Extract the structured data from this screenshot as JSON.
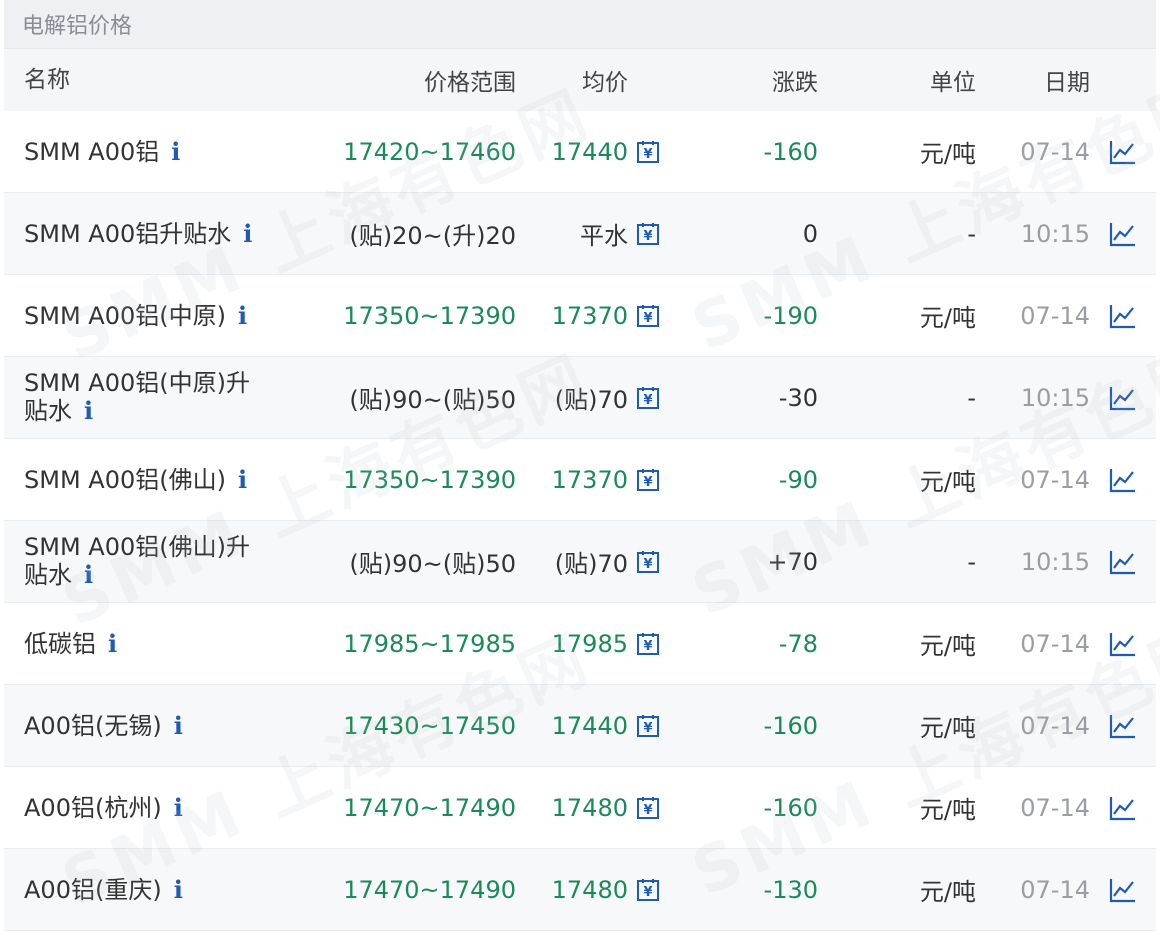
{
  "panel": {
    "title": "电解铝价格"
  },
  "columns": {
    "name": "名称",
    "range": "价格范围",
    "avg": "均价",
    "change": "涨跌",
    "unit": "单位",
    "date": "日期"
  },
  "rows": [
    {
      "name": "SMM A00铝",
      "info": "i",
      "range": "17420~17460",
      "avg": "17440",
      "change": "-160",
      "unit": "元/吨",
      "date": "07-14",
      "style": "price"
    },
    {
      "name": "SMM A00铝升贴水",
      "info": "i",
      "range": "(贴)20~(升)20",
      "avg": "平水",
      "change": "0",
      "unit": "-",
      "date": "10:15",
      "style": "premium"
    },
    {
      "name": "SMM A00铝(中原)",
      "info": "i",
      "range": "17350~17390",
      "avg": "17370",
      "change": "-190",
      "unit": "元/吨",
      "date": "07-14",
      "style": "price"
    },
    {
      "name": "SMM A00铝(中原)升贴水",
      "info": "i",
      "range": "(贴)90~(贴)50",
      "avg": "(贴)70",
      "change": "-30",
      "unit": "-",
      "date": "10:15",
      "style": "premium"
    },
    {
      "name": "SMM A00铝(佛山)",
      "info": "i",
      "range": "17350~17390",
      "avg": "17370",
      "change": "-90",
      "unit": "元/吨",
      "date": "07-14",
      "style": "price"
    },
    {
      "name": "SMM A00铝(佛山)升贴水",
      "info": "i",
      "range": "(贴)90~(贴)50",
      "avg": "(贴)70",
      "change": "+70",
      "unit": "-",
      "date": "10:15",
      "style": "premium"
    },
    {
      "name": "低碳铝",
      "info": "i",
      "range": "17985~17985",
      "avg": "17985",
      "change": "-78",
      "unit": "元/吨",
      "date": "07-14",
      "style": "price"
    },
    {
      "name": "A00铝(无锡)",
      "info": "i",
      "range": "17430~17450",
      "avg": "17440",
      "change": "-160",
      "unit": "元/吨",
      "date": "07-14",
      "style": "price"
    },
    {
      "name": "A00铝(杭州)",
      "info": "i",
      "range": "17470~17490",
      "avg": "17480",
      "change": "-160",
      "unit": "元/吨",
      "date": "07-14",
      "style": "price"
    },
    {
      "name": "A00铝(重庆)",
      "info": "i",
      "range": "17470~17490",
      "avg": "17480",
      "change": "-130",
      "unit": "元/吨",
      "date": "07-14",
      "style": "price"
    }
  ],
  "icons": {
    "avg": "calendar-icon",
    "trend": "line-chart-icon"
  },
  "colors": {
    "price_green": "#1a8a5a",
    "icon_blue": "#1e5bb4",
    "header_bg": "#f5f6f8"
  },
  "watermark": {
    "text": "SMM 上海有色网"
  }
}
